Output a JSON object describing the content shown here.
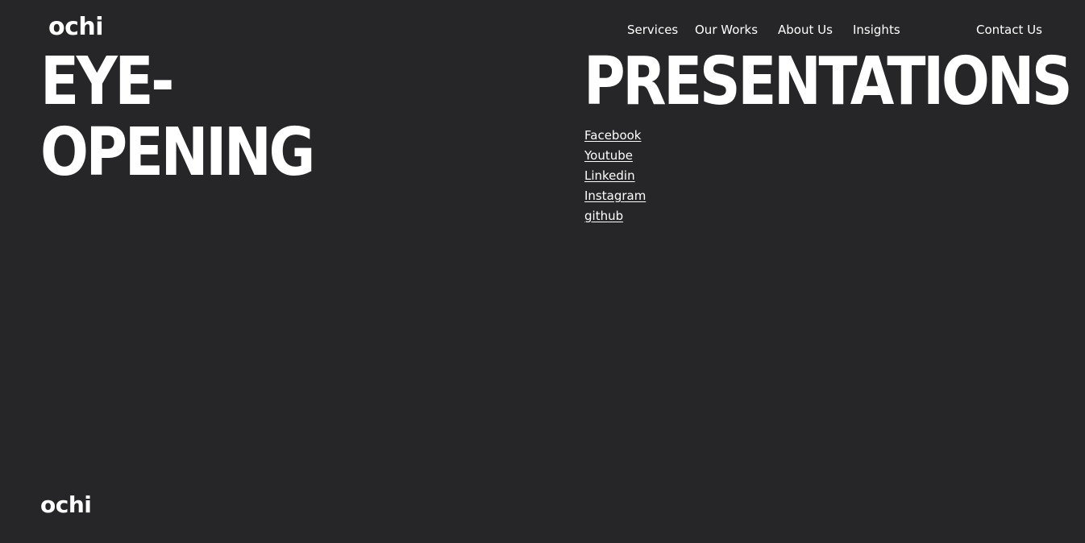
{
  "header": {
    "logo": "ochi",
    "nav": {
      "services": "Services",
      "works": "Our Works",
      "about": "About Us",
      "insights": "Insights",
      "contact": "Contact Us"
    }
  },
  "hero": {
    "left_line_1": "EYE-",
    "left_line_2": "OPENING",
    "right_heading": "PRESENTATIONS"
  },
  "socials": {
    "facebook": "Facebook",
    "youtube": "Youtube",
    "linkedin": "Linkedin",
    "instagram": "Instagram",
    "github": "github"
  },
  "footer": {
    "logo": "ochi"
  }
}
